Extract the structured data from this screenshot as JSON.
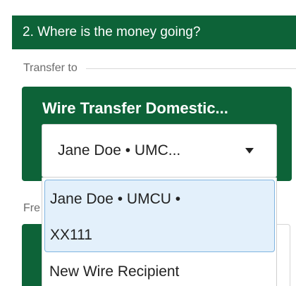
{
  "section": {
    "title": "2. Where is the money going?"
  },
  "transfer": {
    "label": "Transfer to"
  },
  "card": {
    "title": "Wire Transfer Domestic..."
  },
  "select": {
    "value": "Jane Doe • UMC...",
    "caret_icon": "caret-down-icon"
  },
  "dropdown": {
    "options": [
      {
        "line1": "Jane Doe • UMCU •",
        "line2": "XX111",
        "selected": true
      },
      {
        "line1": "New Wire Recipient",
        "selected": false
      }
    ]
  },
  "partial_label": "Fre",
  "colors": {
    "brand_green": "#0d6338",
    "selected_bg": "#e3f0fb",
    "selected_border": "#7fb4e0"
  }
}
